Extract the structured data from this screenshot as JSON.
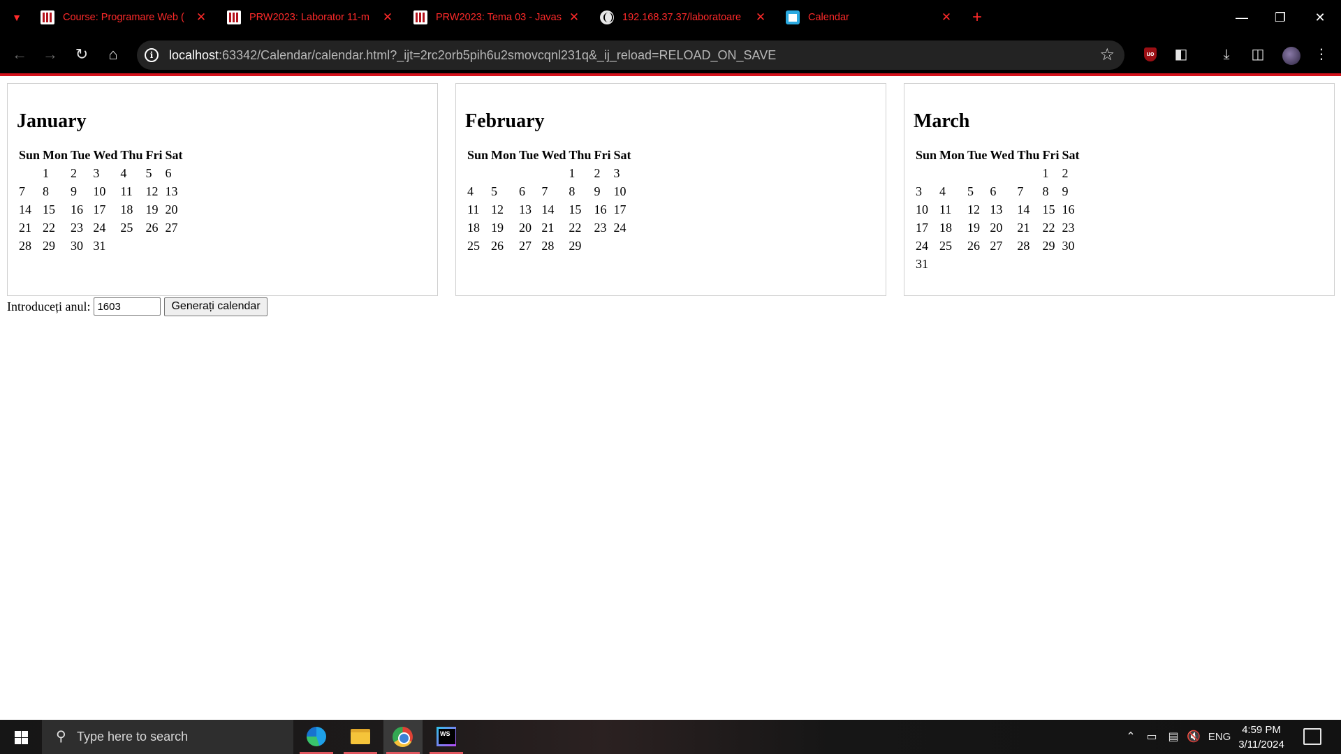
{
  "browser": {
    "tabs": [
      {
        "title": "Course: Programare Web (",
        "favicon": "prw-logo-icon"
      },
      {
        "title": "PRW2023: Laborator 11-m",
        "favicon": "prw-logo-icon"
      },
      {
        "title": "PRW2023: Tema 03 - Javas",
        "favicon": "prw-logo-icon"
      },
      {
        "title": "192.168.37.37/laboratoare",
        "favicon": "globe-icon"
      },
      {
        "title": "Calendar",
        "favicon": "calendar-app-icon"
      }
    ],
    "address": {
      "host": "localhost",
      "rest": ":63342/Calendar/calendar.html?_ijt=2rc2orb5pih6u2smovcqnl231q&_ij_reload=RELOAD_ON_SAVE"
    },
    "accent_color": "#ff2a2a",
    "brand_line_color": "#d3121b"
  },
  "page": {
    "weekdays": [
      "Sun",
      "Mon",
      "Tue",
      "Wed",
      "Thu",
      "Fri",
      "Sat"
    ],
    "months": [
      {
        "name": "January",
        "weeks": [
          [
            "",
            "1",
            "2",
            "3",
            "4",
            "5",
            "6"
          ],
          [
            "7",
            "8",
            "9",
            "10",
            "11",
            "12",
            "13"
          ],
          [
            "14",
            "15",
            "16",
            "17",
            "18",
            "19",
            "20"
          ],
          [
            "21",
            "22",
            "23",
            "24",
            "25",
            "26",
            "27"
          ],
          [
            "28",
            "29",
            "30",
            "31",
            "",
            "",
            ""
          ]
        ]
      },
      {
        "name": "February",
        "weeks": [
          [
            "",
            "",
            "",
            "",
            "1",
            "2",
            "3"
          ],
          [
            "4",
            "5",
            "6",
            "7",
            "8",
            "9",
            "10"
          ],
          [
            "11",
            "12",
            "13",
            "14",
            "15",
            "16",
            "17"
          ],
          [
            "18",
            "19",
            "20",
            "21",
            "22",
            "23",
            "24"
          ],
          [
            "25",
            "26",
            "27",
            "28",
            "29",
            "",
            ""
          ]
        ]
      },
      {
        "name": "March",
        "weeks": [
          [
            "",
            "",
            "",
            "",
            "",
            "1",
            "2"
          ],
          [
            "3",
            "4",
            "5",
            "6",
            "7",
            "8",
            "9"
          ],
          [
            "10",
            "11",
            "12",
            "13",
            "14",
            "15",
            "16"
          ],
          [
            "17",
            "18",
            "19",
            "20",
            "21",
            "22",
            "23"
          ],
          [
            "24",
            "25",
            "26",
            "27",
            "28",
            "29",
            "30"
          ],
          [
            "31",
            "",
            "",
            "",
            "",
            "",
            ""
          ]
        ]
      }
    ],
    "year_form": {
      "label": "Introduceți anul:",
      "year_value": "1603",
      "button_label": "Generați calendar"
    }
  },
  "taskbar": {
    "search_placeholder": "Type here to search",
    "pinned_apps": [
      "edge-icon",
      "file-explorer-icon",
      "chrome-icon",
      "webstorm-icon"
    ],
    "language": "ENG",
    "time": "4:59 PM",
    "date": "3/11/2024"
  }
}
